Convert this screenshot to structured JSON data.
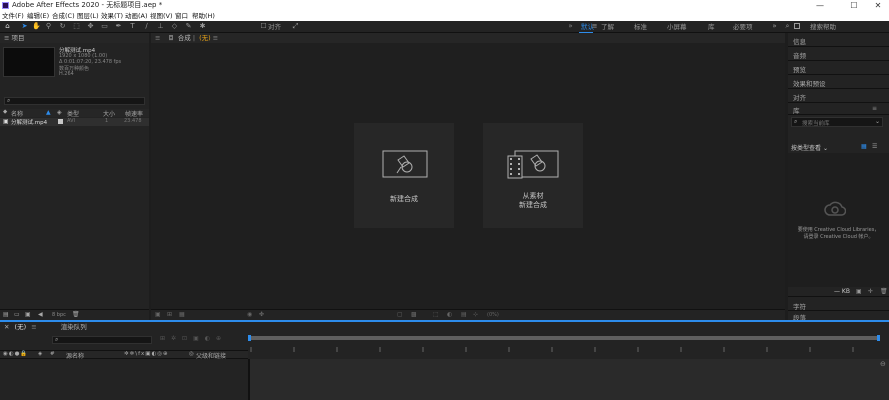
{
  "window": {
    "title": "Adobe After Effects 2020 - 无标题项目.aep *",
    "min": "—",
    "max": "☐",
    "close": "✕"
  },
  "menu": [
    "文件(F)",
    "编辑(E)",
    "合成(C)",
    "图层(L)",
    "效果(T)",
    "动画(A)",
    "视图(V)",
    "窗口",
    "帮助(H)"
  ],
  "toolbar": {
    "snap_label": "对齐",
    "workspaces": [
      "默认",
      "了解",
      "标准",
      "小屏幕",
      "库",
      "必要项"
    ],
    "search_help": "搜索帮助"
  },
  "project": {
    "title": "项目",
    "file_name": "分解测试.mp4",
    "file_info": [
      "1920 x 1080 (1.00)",
      "Δ 0:01:07:20, 23.478 fps",
      "数百万种颜色",
      "H.264"
    ],
    "columns": {
      "name": "名称",
      "type": "类型",
      "size": "大小",
      "rate": "帧速率"
    },
    "rows": [
      {
        "name": "分解测试.mp4",
        "type": "AVI",
        "size": "1",
        "rate": "23.478"
      }
    ],
    "bpc": "8 bpc"
  },
  "composition": {
    "tab": "合成",
    "tab_value": "(无)",
    "cards": [
      {
        "label": "新建合成",
        "icon": "new-composition-icon"
      },
      {
        "label_line1": "从素材",
        "label_line2": "新建合成",
        "icon": "composition-from-footage-icon"
      }
    ],
    "zoom": "(0%)"
  },
  "right_panels": {
    "items": [
      "信息",
      "音频",
      "预览",
      "效果和预设",
      "对齐"
    ],
    "library": "库",
    "library_search": "搜索当前库",
    "library_type": "按类型查看",
    "cc_message_1": "要使用 Creative Cloud Libraries，",
    "cc_message_2": "请登录 Creative Cloud 帐户。",
    "kb": "— KB",
    "bottom_items": [
      "字符",
      "段落"
    ]
  },
  "timeline": {
    "tab_close": "✕",
    "tab_label": "(无)",
    "render_queue": "渲染队列",
    "layer_name_col": "源名称",
    "parent_col": "父级和链接"
  },
  "colors": {
    "accent": "#2d8ceb",
    "bg": "#1d1d1d",
    "panel": "#232323"
  }
}
